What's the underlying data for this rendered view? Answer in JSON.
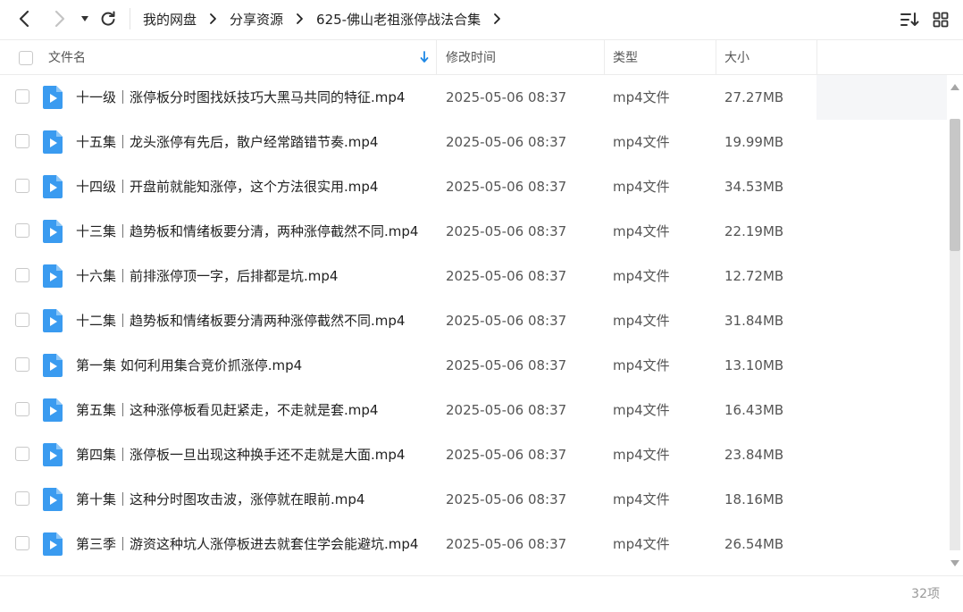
{
  "toolbar": {
    "back_icon": "chevron-left-icon",
    "forward_icon": "chevron-right-icon",
    "history_icon": "caret-down-icon",
    "refresh_icon": "refresh-icon",
    "sort_icon": "sort-icon",
    "grid_icon": "grid-view-icon"
  },
  "breadcrumb": [
    "我的网盘",
    "分享资源",
    "625-佛山老祖涨停战法合集"
  ],
  "columns": {
    "name": "文件名",
    "modified": "修改时间",
    "type": "类型",
    "size": "大小"
  },
  "files": [
    {
      "name": "十一级｜涨停板分时图找妖技巧大黑马共同的特征.mp4",
      "modified": "2025-05-06 08:37",
      "type": "mp4文件",
      "size": "27.27MB"
    },
    {
      "name": "十五集｜龙头涨停有先后，散户经常踏错节奏.mp4",
      "modified": "2025-05-06 08:37",
      "type": "mp4文件",
      "size": "19.99MB"
    },
    {
      "name": "十四级｜开盘前就能知涨停，这个方法很实用.mp4",
      "modified": "2025-05-06 08:37",
      "type": "mp4文件",
      "size": "34.53MB"
    },
    {
      "name": "十三集｜趋势板和情绪板要分清，两种涨停截然不同.mp4",
      "modified": "2025-05-06 08:37",
      "type": "mp4文件",
      "size": "22.19MB"
    },
    {
      "name": "十六集｜前排涨停顶一字，后排都是坑.mp4",
      "modified": "2025-05-06 08:37",
      "type": "mp4文件",
      "size": "12.72MB"
    },
    {
      "name": "十二集｜趋势板和情绪板要分清两种涨停截然不同.mp4",
      "modified": "2025-05-06 08:37",
      "type": "mp4文件",
      "size": "31.84MB"
    },
    {
      "name": "第一集  如何利用集合竞价抓涨停.mp4",
      "modified": "2025-05-06 08:37",
      "type": "mp4文件",
      "size": "13.10MB"
    },
    {
      "name": "第五集｜这种涨停板看见赶紧走，不走就是套.mp4",
      "modified": "2025-05-06 08:37",
      "type": "mp4文件",
      "size": "16.43MB"
    },
    {
      "name": "第四集｜涨停板一旦出现这种换手还不走就是大面.mp4",
      "modified": "2025-05-06 08:37",
      "type": "mp4文件",
      "size": "23.84MB"
    },
    {
      "name": "第十集｜这种分时图攻击波，涨停就在眼前.mp4",
      "modified": "2025-05-06 08:37",
      "type": "mp4文件",
      "size": "18.16MB"
    },
    {
      "name": "第三季｜游资这种坑人涨停板进去就套住学会能避坑.mp4",
      "modified": "2025-05-06 08:37",
      "type": "mp4文件",
      "size": "26.54MB"
    }
  ],
  "footer": {
    "count": "32项"
  },
  "colors": {
    "file_icon": "#3a9bf0",
    "sort_arrow": "#1e88e5"
  }
}
